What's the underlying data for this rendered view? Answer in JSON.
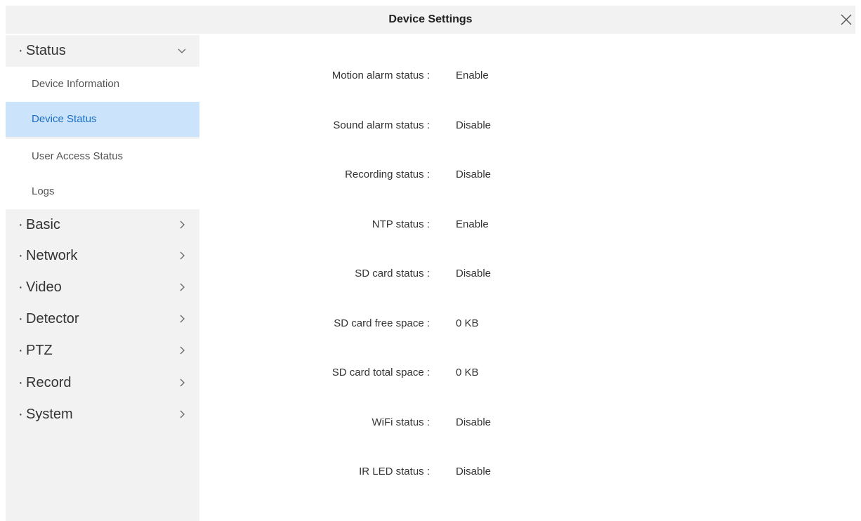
{
  "window": {
    "title": "Device Settings",
    "close_icon": "close-icon"
  },
  "sidebar": {
    "bullet": "·",
    "groups": [
      {
        "label": "Status",
        "expanded": true,
        "icon": "chevron-down-icon",
        "items": [
          {
            "label": "Device Information",
            "active": false
          },
          {
            "label": "Device Status",
            "active": true
          },
          {
            "label": "User Access Status",
            "active": false
          },
          {
            "label": "Logs",
            "active": false
          }
        ]
      },
      {
        "label": "Basic",
        "expanded": false,
        "icon": "chevron-right-icon"
      },
      {
        "label": "Network",
        "expanded": false,
        "icon": "chevron-right-icon"
      },
      {
        "label": "Video",
        "expanded": false,
        "icon": "chevron-right-icon"
      },
      {
        "label": "Detector",
        "expanded": false,
        "icon": "chevron-right-icon"
      },
      {
        "label": "PTZ",
        "expanded": false,
        "icon": "chevron-right-icon"
      },
      {
        "label": "Record",
        "expanded": false,
        "icon": "chevron-right-icon"
      },
      {
        "label": "System",
        "expanded": false,
        "icon": "chevron-right-icon"
      }
    ]
  },
  "status": {
    "rows": [
      {
        "label": "Motion alarm status :",
        "value": "Enable"
      },
      {
        "label": "Sound alarm status :",
        "value": "Disable"
      },
      {
        "label": "Recording status :",
        "value": "Disable"
      },
      {
        "label": "NTP status :",
        "value": "Enable"
      },
      {
        "label": "SD card status :",
        "value": "Disable"
      },
      {
        "label": "SD card free space :",
        "value": "0 KB"
      },
      {
        "label": "SD card total space :",
        "value": "0 KB"
      },
      {
        "label": "WiFi status :",
        "value": "Disable"
      },
      {
        "label": "IR LED status :",
        "value": "Disable"
      }
    ]
  },
  "colors": {
    "panel_bg": "#f2f2f2",
    "active_bg": "#cce4fb",
    "active_text": "#1a6fc9"
  }
}
